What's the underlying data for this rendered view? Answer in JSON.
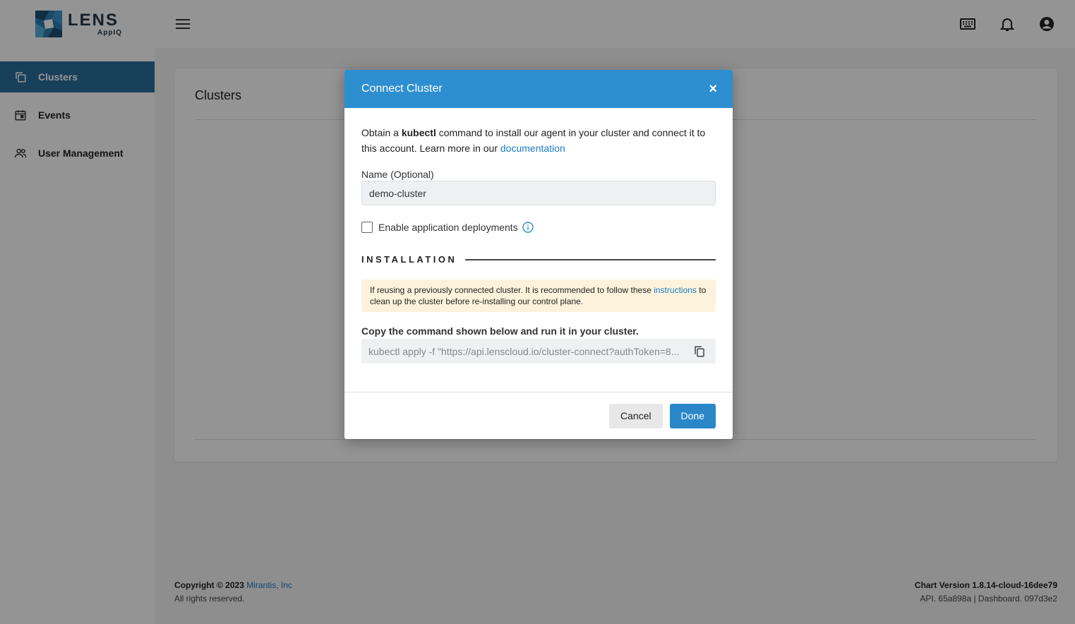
{
  "logo": {
    "main": "LENS",
    "sub": "AppIQ"
  },
  "sidebar": {
    "items": [
      {
        "label": "Clusters",
        "icon": "copy-stack-icon",
        "active": true
      },
      {
        "label": "Events",
        "icon": "calendar-icon",
        "active": false
      },
      {
        "label": "User Management",
        "icon": "users-icon",
        "active": false
      }
    ]
  },
  "topbar": {
    "icons": [
      "menu-icon",
      "keyboard-icon",
      "bell-icon",
      "account-icon"
    ]
  },
  "page": {
    "title": "Clusters"
  },
  "footer": {
    "copyright_prefix": "Copyright © 2023 ",
    "company_link": "Mirantis, Inc",
    "rights": "All rights reserved.",
    "chart_version": "Chart Version 1.8.14-cloud-16dee79",
    "build_info": "API. 65a898a | Dashboard. 097d3e2"
  },
  "modal": {
    "title": "Connect Cluster",
    "close_label": "×",
    "intro_1": "Obtain a ",
    "intro_bold": "kubectl",
    "intro_2": " command to install our agent in your cluster and connect it to this account. Learn more in our ",
    "intro_link": "documentation",
    "name_label": "Name (Optional)",
    "name_value": "demo-cluster",
    "checkbox_label": "Enable application deployments",
    "checkbox_checked": false,
    "section_title": "INSTALLATION",
    "warning_text": "If reusing a previously connected cluster. It is recommended to follow these ",
    "warning_link": "instructions",
    "warning_text_2": " to clean up the cluster before re-installing our control plane.",
    "command_label": "Copy the command shown below and run it in your cluster.",
    "command_value": "kubectl apply -f \"https://api.lenscloud.io/cluster-connect?authToken=8...",
    "cancel_label": "Cancel",
    "done_label": "Done"
  },
  "colors": {
    "accent": "#2d8fd0",
    "sidebar_active": "#2a6f9e",
    "link": "#1e7bc1",
    "warning_bg": "#fdf3dc"
  }
}
